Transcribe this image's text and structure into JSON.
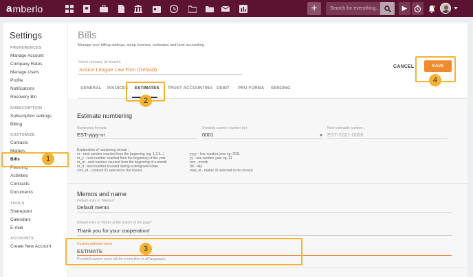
{
  "brand": {
    "logo_mark": "a",
    "logo_text": "mberlo"
  },
  "topbar": {
    "nav_icons": [
      "dashboard-icon",
      "contacts-icon",
      "matters-icon",
      "documents-icon",
      "bank-icon",
      "calendar-icon",
      "time-icon",
      "folder-icon",
      "files-icon",
      "mail-icon",
      "reports-icon"
    ],
    "plus_label": "+",
    "search_placeholder": "Search for everything...",
    "play_label": "▶",
    "timer_label": "◷",
    "bell_label": "🔔"
  },
  "settings": {
    "title": "Settings",
    "sections": [
      {
        "label": "PREFERENCES",
        "items": [
          "Manage Account",
          "Company Rates",
          "Manage Users",
          "Profile",
          "Notifications",
          "Recovery Bin"
        ]
      },
      {
        "label": "SUBSCRIPTION",
        "items": [
          "Subscription settings",
          "Billing"
        ]
      },
      {
        "label": "CUSTOMIZE",
        "items": [
          "Contacts",
          "Matters",
          "Bills",
          "Planning",
          "Activities",
          "Contracts",
          "Documents"
        ]
      },
      {
        "label": "TOOLS",
        "items": [
          "Sharepoint",
          "Calendars",
          "E-mail"
        ]
      },
      {
        "label": "ACCOUNTS",
        "items": [
          "Create New Account"
        ]
      }
    ],
    "active_item": "Bills"
  },
  "main": {
    "title": "Bills",
    "subtitle": "Manage your billing settings, setup invoices, estimates and trust accounting",
    "company_label": "Select company (or branch)",
    "company_value": "Justice League Law Firm (Default)",
    "cancel_label": "CANCEL",
    "save_label": "SAVE",
    "tabs": [
      "GENERAL",
      "INVOICES",
      "ESTIMATES",
      "TRUST ACCOUNTING",
      "DEBIT",
      "PRO FORMA",
      "SENDING"
    ],
    "active_tab": "ESTIMATES",
    "estimate_numbering": {
      "title": "Estimate numbering",
      "formula_label": "Numbering formula",
      "formula_value": "EST-yyyy-nr",
      "symbols_label": "Symbols count in number (nr)",
      "symbols_value": "0001",
      "next_label": "Next estimable number...",
      "next_value": "EST-2021-0006",
      "explanation_left": "Explanation of numbering format :\nnr - next number counted from the beginning (eg. 1,2,3...)\nnr_y - next number counted from the beginning of the year\nnr_m - next number counted from the beginning of a month\nnr_d - next number counted during a designated date\ncont_id - contract ID selected in the invoice",
      "explanation_right": "\nyyyy - four number year eg. 2011\nyy - two number year eg. 11\nmm - month\ndd - day\nmatt_id - matter ID selected in the invoice"
    },
    "memos": {
      "title": "Memos and name",
      "memo_label": "Default entry in \"Memos\"",
      "memo_value": "Default memo",
      "notes_label": "Default entry in \"Notes at the bottom of the page\"",
      "notes_value": "Thank you for your cooperation!",
      "custom_label": "Custom estimate name",
      "custom_value": "ESTIMATE",
      "custom_hint": "Provided custom name will be overwritten in all languages."
    }
  },
  "annotations": [
    "1",
    "2",
    "3",
    "4"
  ],
  "colors": {
    "topbar": "#5b1331",
    "accent": "#f08a2e",
    "highlight": "#f5b330",
    "company": "#ee7a2a"
  }
}
